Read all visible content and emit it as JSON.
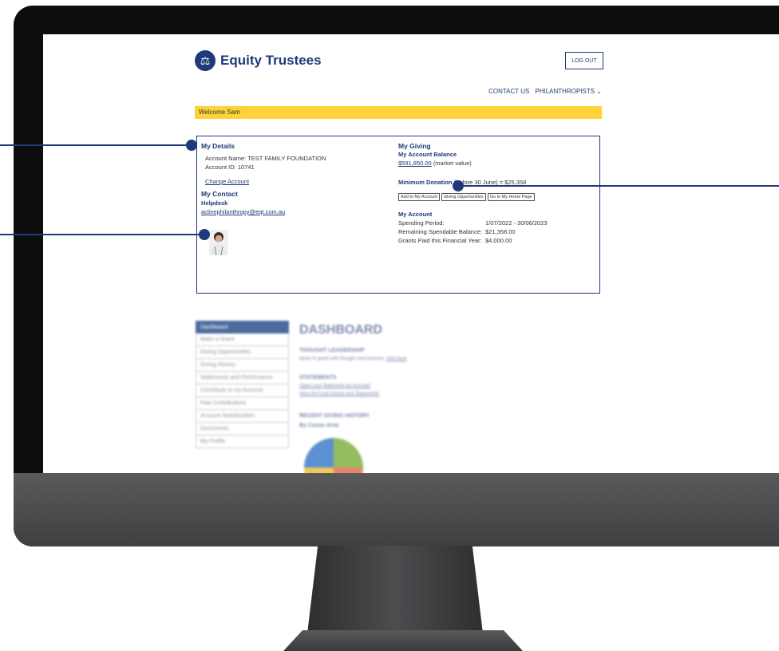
{
  "brand": {
    "name": "Equity Trustees",
    "icon": "scales-icon"
  },
  "header": {
    "logout_label": "LOG OUT",
    "contact_label": "CONTACT US",
    "philanthropists_label": "PHILANTHROPISTS",
    "chevron": "⌄"
  },
  "welcome": "Welcome Sam",
  "details": {
    "title": "My Details",
    "account_name": "Account Name: TEST FAMILY FOUNDATION",
    "account_id": "Account ID: 10741",
    "change_account": "Change Account"
  },
  "contact": {
    "title": "My Contact",
    "name": "Helpdesk",
    "email": "activephilanthropy@eqt.com.au"
  },
  "giving": {
    "title": "My Giving",
    "balance_title": "My Account Balance",
    "balance_value": "$591,850.00",
    "balance_suffix": "(market value)",
    "min_donation_label": "Minimum Donation",
    "min_donation_text": "(before 30 June) = $25,358",
    "buttons": [
      "Add to My Account",
      "Giving Opportunities",
      "Go to My Home Page"
    ]
  },
  "account": {
    "title": "My Account",
    "rows": [
      {
        "label": "Spending Period:",
        "value": "1/07/2022 - 30/06/2023"
      },
      {
        "label": "Remaining Spendable Balance:",
        "value": "$21,358.00"
      },
      {
        "label": "Grants Paid this Financial Year:",
        "value": "$4,000.00"
      }
    ]
  },
  "sidebar": {
    "items": [
      "Dashboard",
      "Make a Grant",
      "Giving Opportunities",
      "Giving History",
      "Statements and Performance",
      "Contribute to my Account",
      "Past Contributions",
      "Account Stakeholders",
      "Documents",
      "My Profile"
    ]
  },
  "dashboard": {
    "title": "DASHBOARD",
    "thought_title": "THOUGHT LEADERSHIP",
    "thought_text": "Ideas to grant with thought and purpose,",
    "thought_link": "click here",
    "statements_title": "STATEMENTS",
    "statement_link1": "Open Last Statement (to Accrual)",
    "statement_link2": "View All Fund Activity and Statements",
    "recent_title": "RECENT GIVING HISTORY",
    "by_cause": "By Cause Area"
  },
  "colors": {
    "brand": "#1f3a78",
    "welcome_bar": "#fed33a",
    "menu_active": "#4d6b9e"
  }
}
